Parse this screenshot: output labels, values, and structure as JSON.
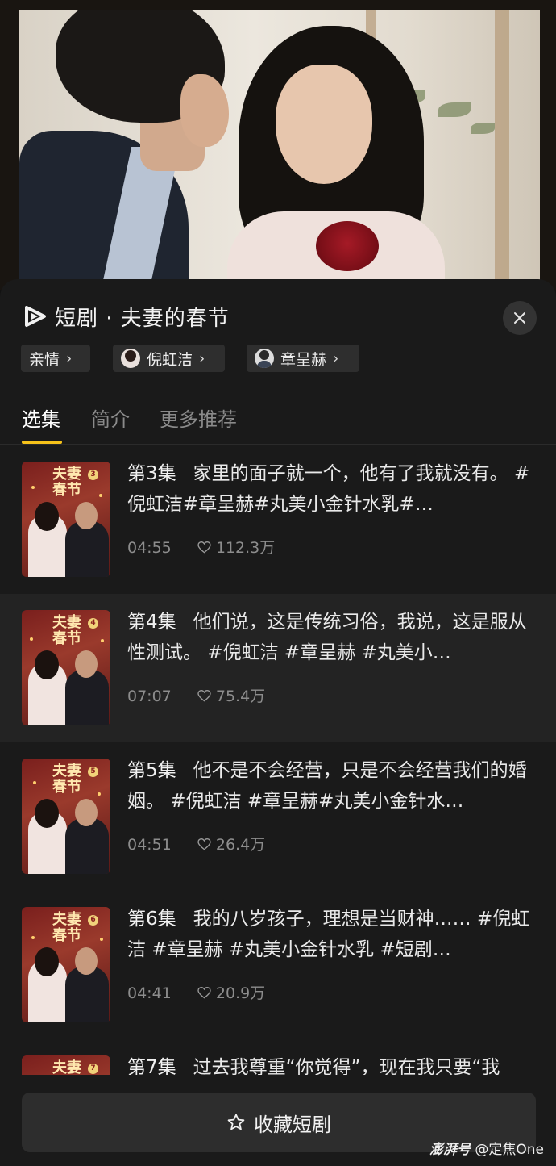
{
  "sheet": {
    "title": "短剧 · 夫妻的春节",
    "close_icon": "close-icon",
    "brand_icon": "short-drama-logo-icon"
  },
  "tags": [
    {
      "label": "亲情"
    },
    {
      "label": "倪虹洁"
    },
    {
      "label": "章呈赫"
    }
  ],
  "tabs": [
    {
      "label": "选集",
      "active": true
    },
    {
      "label": "简介",
      "active": false
    },
    {
      "label": "更多推荐",
      "active": false
    }
  ],
  "episodes": [
    {
      "number": "第3集",
      "text": "家里的面子就一个，他有了我就没有。 #倪虹洁#章呈赫#丸美小金针水乳#…",
      "duration": "04:55",
      "likes": "112.3万",
      "thumb_badge": "3",
      "thumb_title_1": "夫妻",
      "thumb_title_2": "春节"
    },
    {
      "number": "第4集",
      "text": "他们说，这是传统习俗，我说，这是服从性测试。 #倪虹洁 #章呈赫 #丸美小…",
      "duration": "07:07",
      "likes": "75.4万",
      "thumb_badge": "4",
      "thumb_title_1": "夫妻",
      "thumb_title_2": "春节"
    },
    {
      "number": "第5集",
      "text": "他不是不会经营，只是不会经营我们的婚姻。 #倪虹洁 #章呈赫#丸美小金针水…",
      "duration": "04:51",
      "likes": "26.4万",
      "thumb_badge": "5",
      "thumb_title_1": "夫妻",
      "thumb_title_2": "春节"
    },
    {
      "number": "第6集",
      "text": "我的八岁孩子，理想是当财神…… #倪虹洁 #章呈赫 #丸美小金针水乳 #短剧…",
      "duration": "04:41",
      "likes": "20.9万",
      "thumb_badge": "6",
      "thumb_title_1": "夫妻",
      "thumb_title_2": "春节"
    }
  ],
  "partial_episode": {
    "number": "第7集",
    "text": "过去我尊重“你觉得”，现在我只要“我",
    "thumb_badge": "7",
    "thumb_title_1": "夫妻"
  },
  "footer": {
    "favorite_label": "收藏短剧"
  },
  "watermark": {
    "brand": "澎湃号",
    "account": "@定焦One"
  },
  "colors": {
    "accent_underline": "#f6c21a",
    "sheet_bg": "#1a1a1a",
    "highlight_row": "#232323"
  }
}
